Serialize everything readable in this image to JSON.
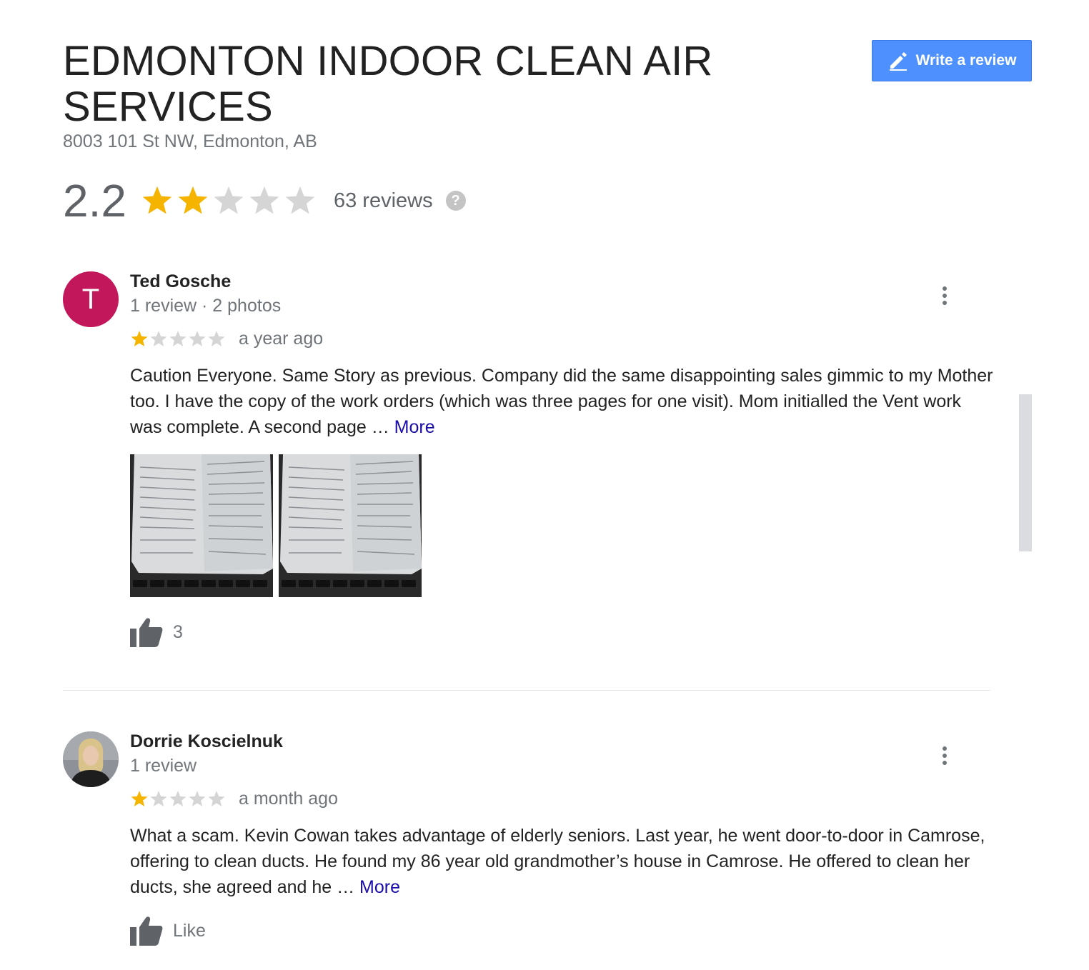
{
  "business": {
    "name": "EDMONTON INDOOR CLEAN AIR SERVICES",
    "address": "8003 101 St NW, Edmonton, AB"
  },
  "summary": {
    "rating": "2.2",
    "rating_stars": 2,
    "max_stars": 5,
    "reviews_count": "63 reviews",
    "help_icon": "question-icon",
    "help_glyph": "?"
  },
  "write_review": {
    "label": "Write a review",
    "icon": "pencil-icon"
  },
  "colors": {
    "star_filled": "#f4b400",
    "star_empty": "#d5d5d5",
    "button_blue": "#4d90fe",
    "link_blue": "#1a0dab",
    "avatar_ted": "#c2185b"
  },
  "reviews": [
    {
      "avatar_letter": "T",
      "name": "Ted Gosche",
      "meta": "1 review · 2 photos",
      "stars": 1,
      "time": "a year ago",
      "text": "Caution Everyone. Same Story as previous. Company did the same disappointing sales gimmic to my Mother too. I have the copy of the work orders (which was three pages for one visit). Mom initialled the Vent work was complete. A second page … ",
      "more_label": "More",
      "photos_count": 2,
      "like_label": "3"
    },
    {
      "avatar_letter": "",
      "name": "Dorrie Koscielnuk",
      "meta": "1 review",
      "stars": 1,
      "time": "a month ago",
      "text": "What a scam. Kevin Cowan takes advantage of elderly seniors. Last year, he went door-to-door in Camrose, offering to clean ducts. He found my 86 year old grandmother’s house in Camrose. He offered to clean her ducts, she agreed and he … ",
      "more_label": "More",
      "photos_count": 0,
      "like_label": "Like"
    }
  ]
}
